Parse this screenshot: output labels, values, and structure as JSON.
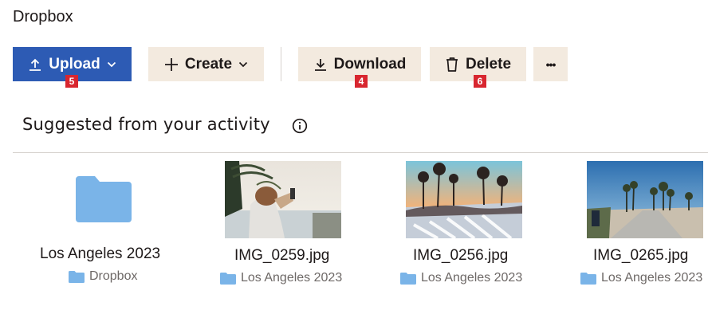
{
  "app": {
    "title": "Dropbox"
  },
  "toolbar": {
    "upload_label": "Upload",
    "create_label": "Create",
    "download_label": "Download",
    "delete_label": "Delete",
    "more_label": "•••"
  },
  "badges": {
    "upload": "5",
    "download": "4",
    "delete": "6"
  },
  "suggested": {
    "title": "Suggested from your activity",
    "items": [
      {
        "name": "Los Angeles 2023",
        "location": "Dropbox",
        "type": "folder"
      },
      {
        "name": "IMG_0259.jpg",
        "location": "Los Angeles 2023",
        "type": "image"
      },
      {
        "name": "IMG_0256.jpg",
        "location": "Los Angeles 2023",
        "type": "image"
      },
      {
        "name": "IMG_0265.jpg",
        "location": "Los Angeles 2023",
        "type": "image"
      }
    ]
  },
  "colors": {
    "primary": "#2d5bb4",
    "secondary": "#f3eadf",
    "badge": "#d8262f",
    "folder": "#7ab4e8"
  }
}
